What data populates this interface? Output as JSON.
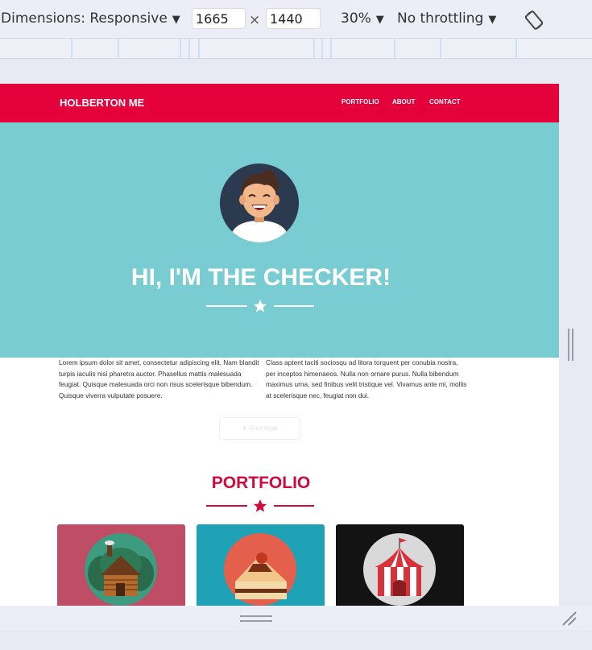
{
  "devtools": {
    "dimensions_label": "Dimensions: Responsive",
    "width_value": "1665",
    "height_value": "1440",
    "times_sign": "×",
    "zoom": "30%",
    "throttling": "No throttling",
    "caret": "▼"
  },
  "site": {
    "brand": "HOLBERTON ME",
    "nav": [
      "PORTFOLIO",
      "ABOUT",
      "CONTACT"
    ],
    "hero_title": "HI, I'M THE CHECKER!",
    "about_left": "Lorem ipsum dolor sit amet, consectetur adipiscing elit. Nam blandit turpis iaculis nisi pharetra auctor. Phasellus mattis malesuada feugiat. Quisque malesuada orci non risus scelerisque bibendum. Quisque viverra vulputate posuere.",
    "about_right": "Class aptent taciti sociosqu ad litora torquent per conubia nostra, per inceptos himenaeos. Nulla non ornare purus. Nulla bibendum maximus urna, sed finibus velit tristique vel. Vivamus ante mi, mollis at scelerisque nec, feugiat non dui.",
    "download_label": "Download",
    "portfolio_title": "PORTFOLIO"
  },
  "colors": {
    "nav_bg": "#e3003b",
    "hero_bg": "#79cdd2",
    "accent": "#d10a3e",
    "card1": "#bf4d66",
    "card2": "#1fa2b6",
    "card3": "#131313"
  },
  "icons": [
    "caret-down-icon",
    "rotate-icon",
    "star-icon",
    "download-icon",
    "cabin-icon",
    "cake-icon",
    "circus-tent-icon",
    "resize-icon"
  ]
}
